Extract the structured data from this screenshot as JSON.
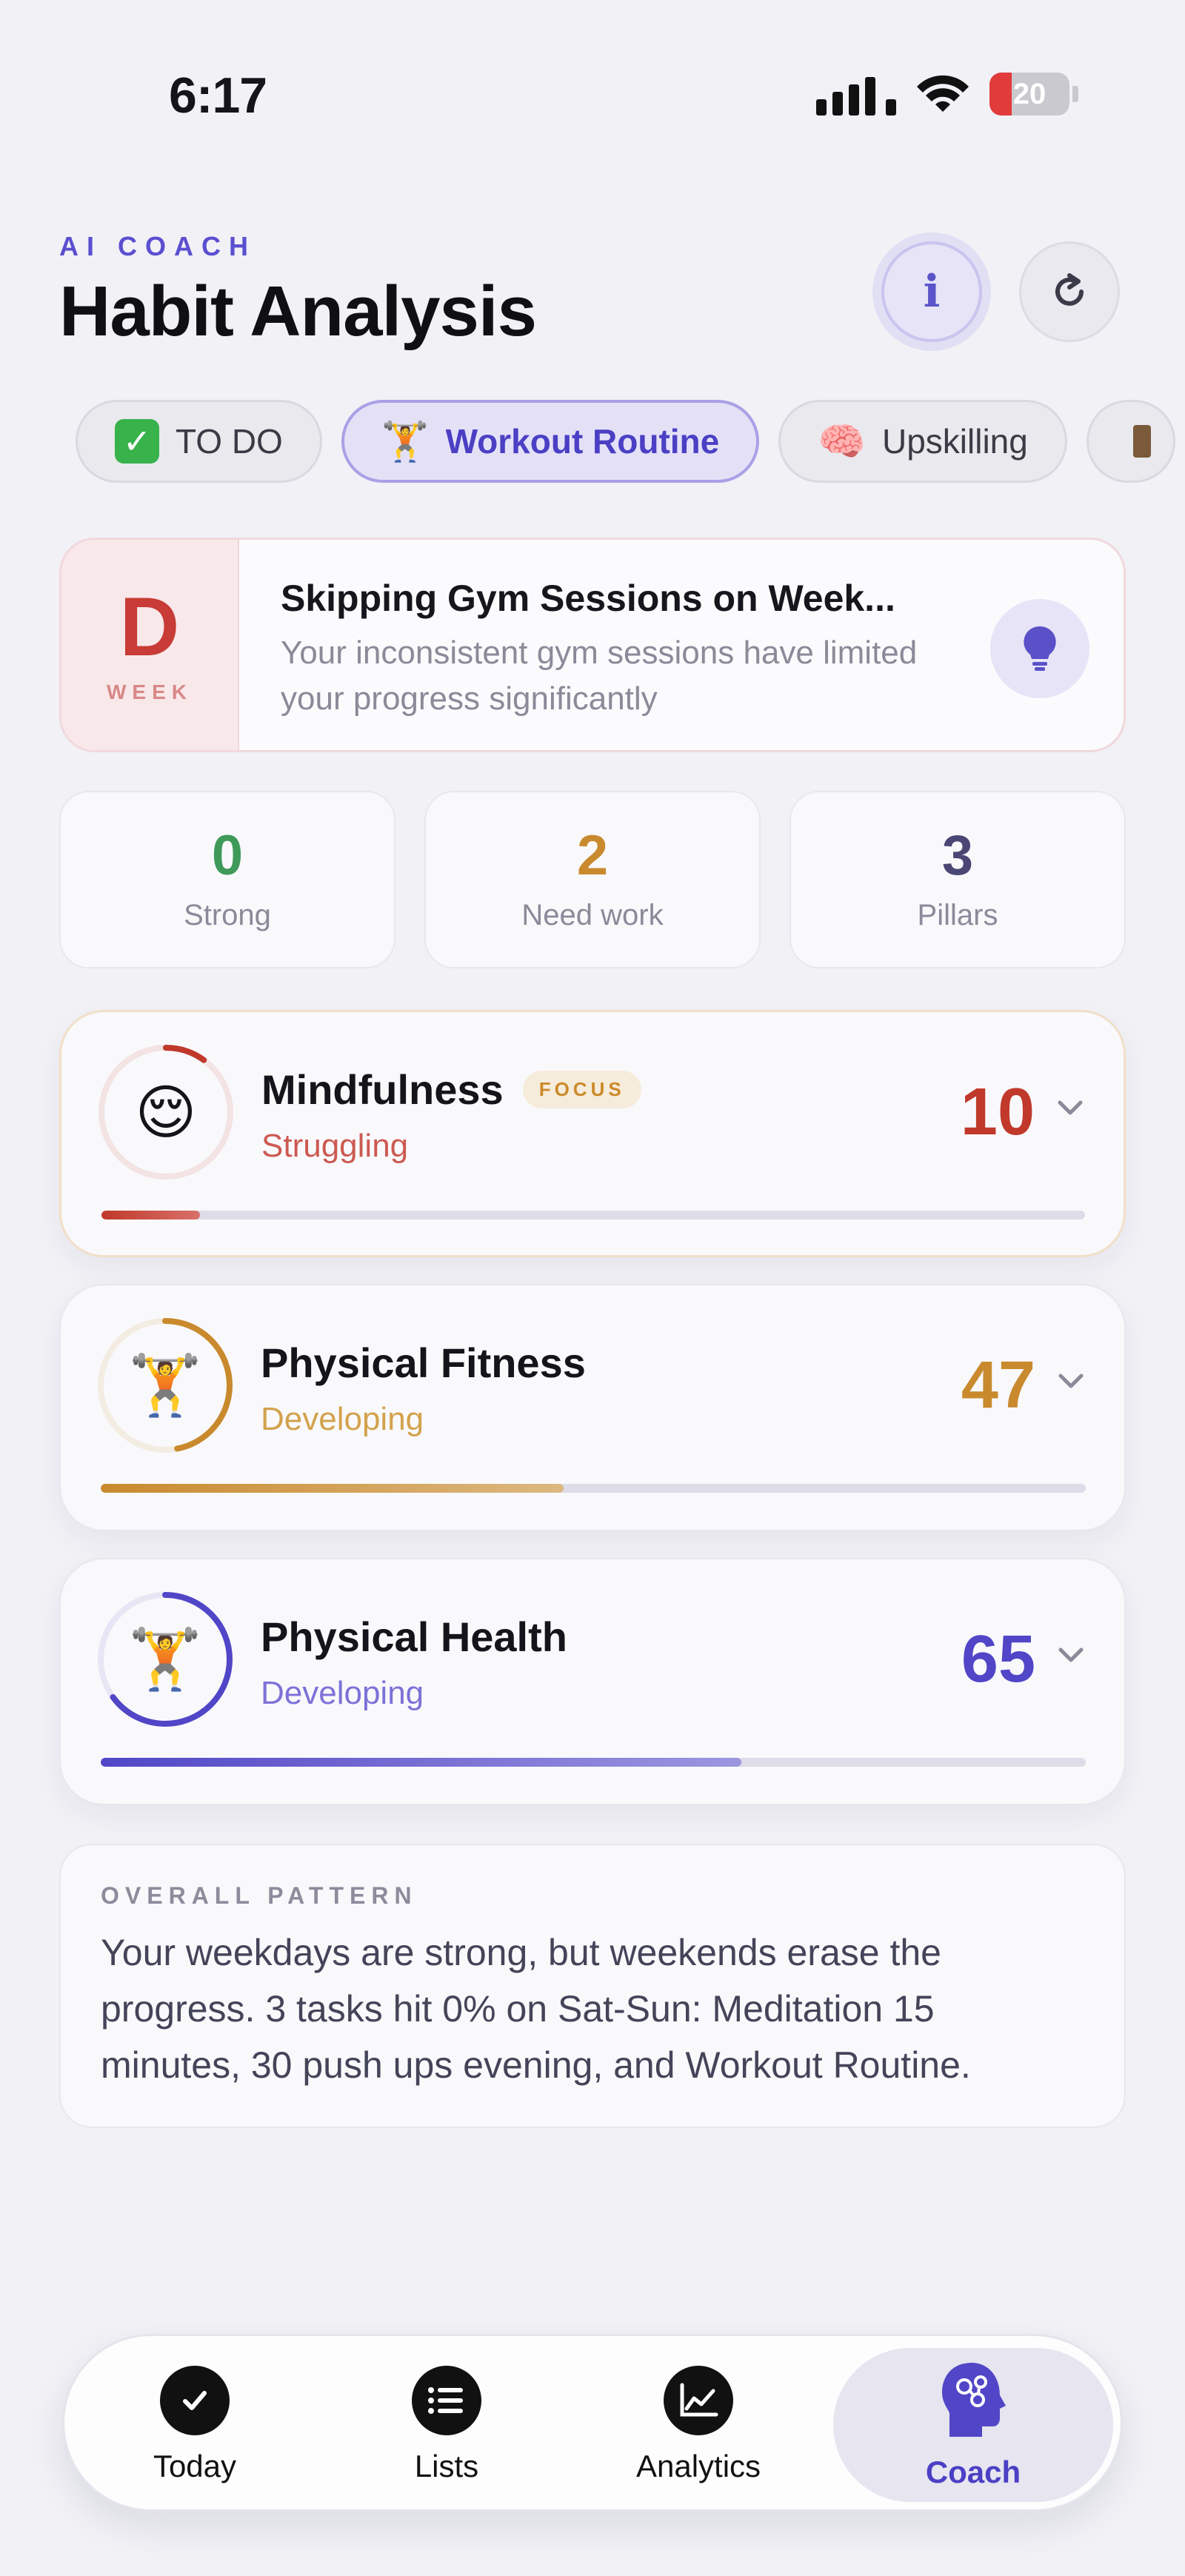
{
  "status_bar": {
    "time": "6:17",
    "battery": "20"
  },
  "header": {
    "eyebrow": "AI COACH",
    "title": "Habit Analysis",
    "info_icon": "info-icon",
    "refresh_icon": "refresh-icon"
  },
  "tabs": [
    {
      "emoji": "✓",
      "label": "TO DO",
      "active": false
    },
    {
      "emoji": "🏋️",
      "label": "Workout Routine",
      "active": true
    },
    {
      "emoji": "🧠",
      "label": "Upskilling",
      "active": false
    }
  ],
  "insight": {
    "grade": "D",
    "grade_sub": "WEEK",
    "title": "Skipping Gym Sessions on Week...",
    "description": "Your inconsistent gym sessions have limited your progress significantly",
    "icon": "lightbulb-icon"
  },
  "stats": [
    {
      "value": "0",
      "label": "Strong",
      "color": "#3f9a5a"
    },
    {
      "value": "2",
      "label": "Need work",
      "color": "#c98a2e"
    },
    {
      "value": "3",
      "label": "Pillars",
      "color": "#4a4775"
    }
  ],
  "pillars": [
    {
      "name": "Mindfulness",
      "emoji": "😌",
      "status": "Struggling",
      "score": "10",
      "progress": 0.1,
      "badge": "FOCUS",
      "color": "#c0392b",
      "status_color": "#cc5a52"
    },
    {
      "name": "Physical Fitness",
      "emoji": "🏋️",
      "status": "Developing",
      "score": "47",
      "progress": 0.47,
      "badge": "",
      "color": "#c98a2e",
      "status_color": "#d3a24c"
    },
    {
      "name": "Physical Health",
      "emoji": "🏋️",
      "status": "Developing",
      "score": "65",
      "progress": 0.65,
      "badge": "",
      "color": "#5146c7",
      "status_color": "#7d72d8"
    }
  ],
  "overall_pattern": {
    "label": "OVERALL PATTERN",
    "text": "Your weekdays are strong, but weekends erase the progress. 3 tasks hit 0% on Sat-Sun: Meditation 15 minutes, 30 push ups evening, and Workout Routine."
  },
  "nav": [
    {
      "label": "Today",
      "icon": "check-icon",
      "active": false
    },
    {
      "label": "Lists",
      "icon": "list-icon",
      "active": false
    },
    {
      "label": "Analytics",
      "icon": "chart-icon",
      "active": false
    },
    {
      "label": "Coach",
      "icon": "brain-head-icon",
      "active": true
    }
  ]
}
